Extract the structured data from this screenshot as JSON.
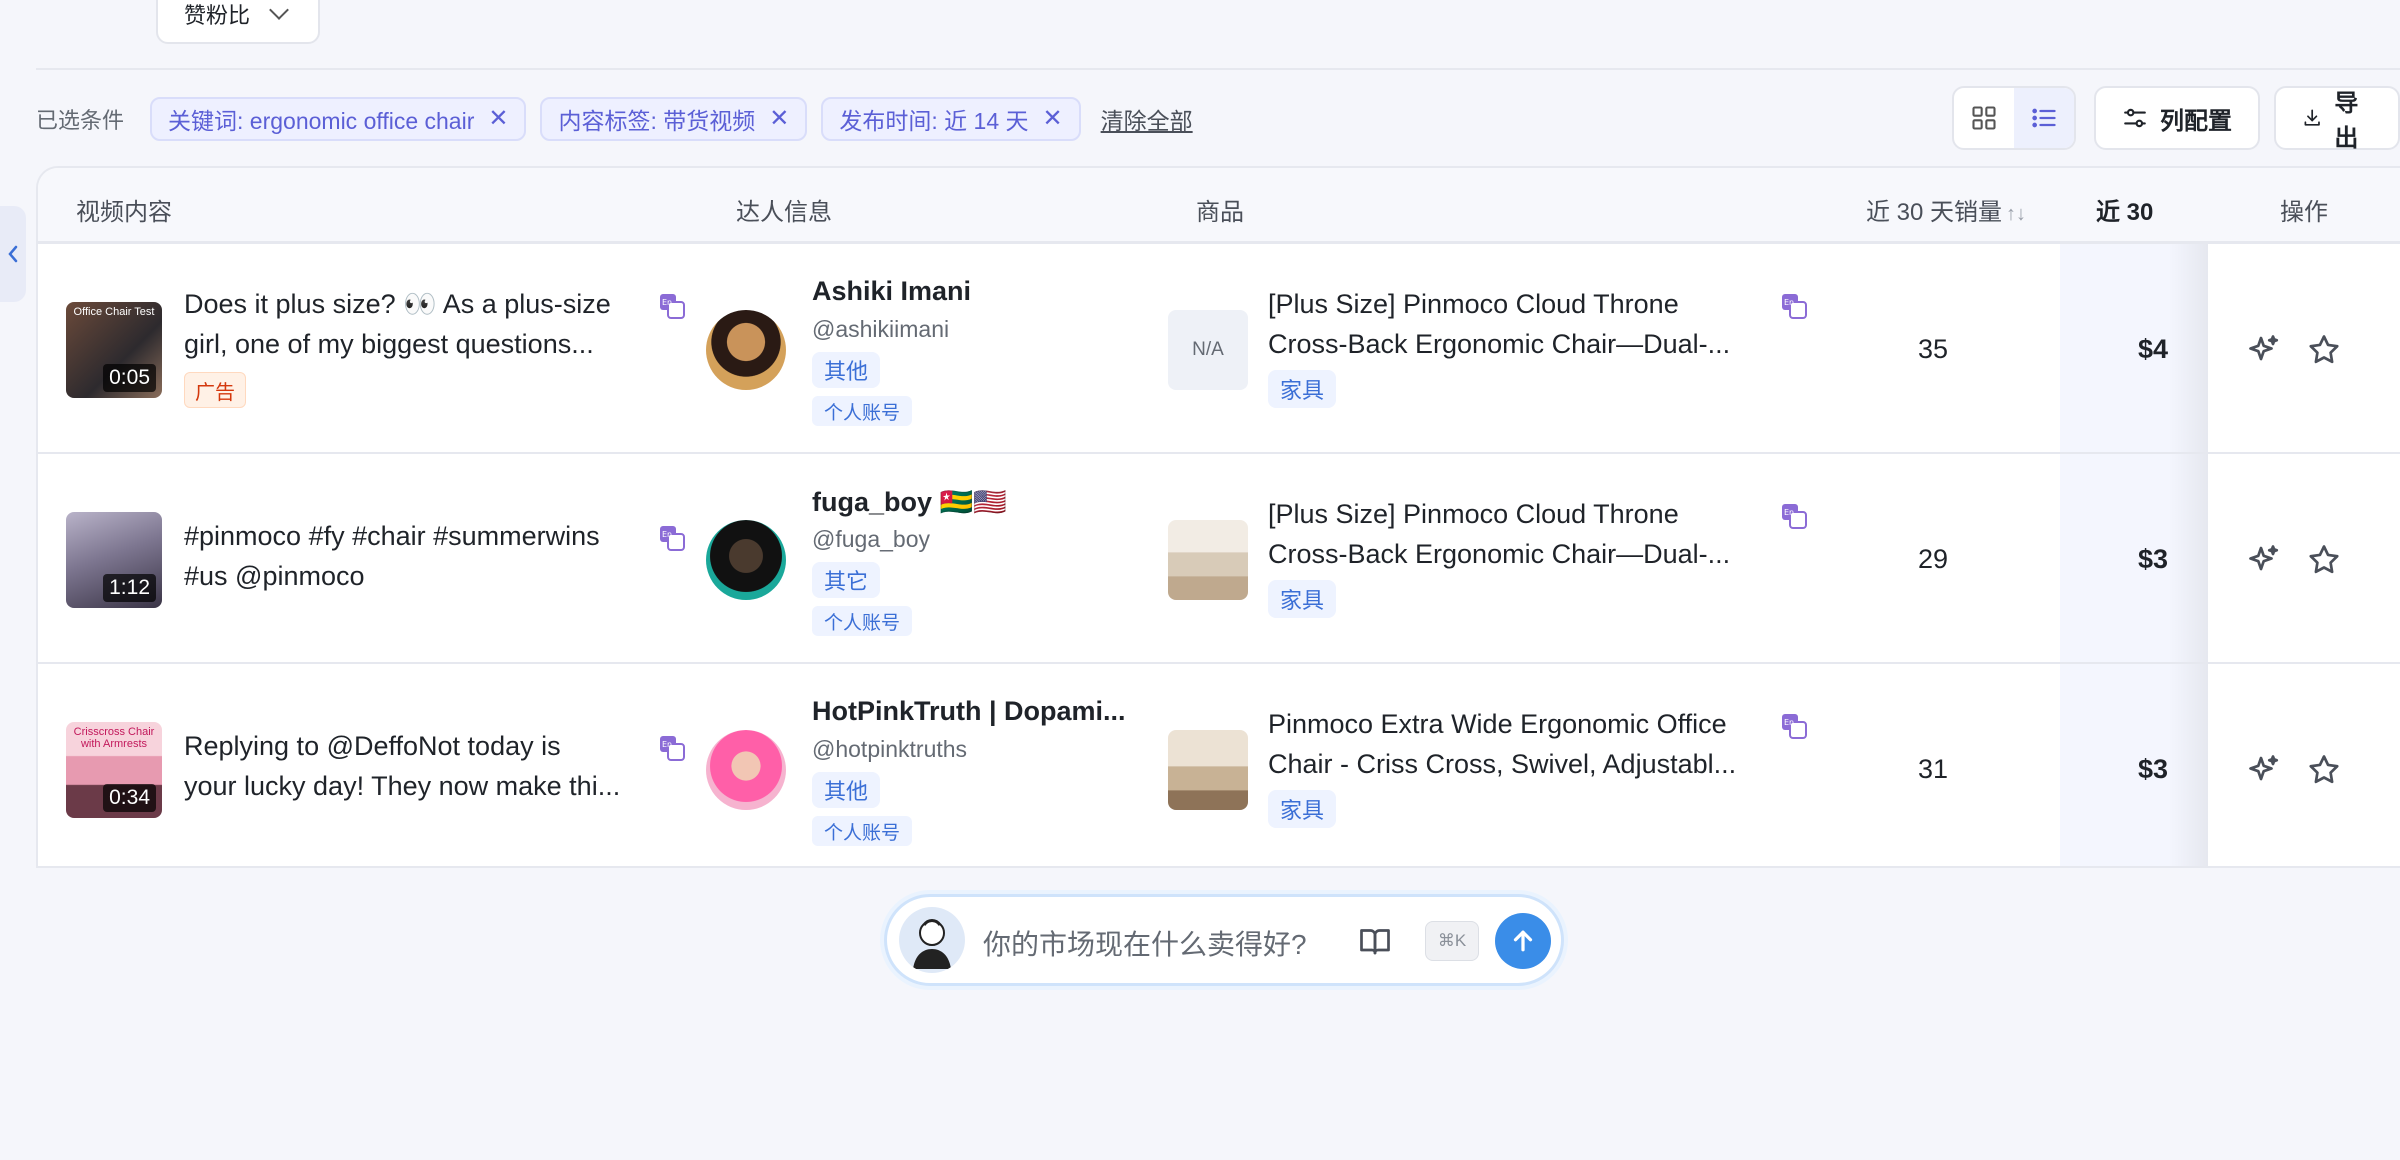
{
  "toolbar": {
    "sort_value": "赞粉比",
    "filter_label": "已选条件",
    "chips": [
      {
        "label": "关键词: ergonomic office chair"
      },
      {
        "label": "内容标签: 带货视频"
      },
      {
        "label": "发布时间: 近 14 天"
      }
    ],
    "clear_all": "清除全部",
    "columns_btn": "列配置",
    "export_btn": "导出"
  },
  "table": {
    "headers": {
      "video": "视频内容",
      "creator": "达人信息",
      "product": "商品",
      "sales": "近 30 天销量",
      "gmv": "近 30",
      "actions": "操作"
    },
    "rows": [
      {
        "duration": "0:05",
        "thumb_caption": "Office Chair Test",
        "video_title_l1": "Does it plus size? 👀 As a plus-size",
        "video_title_l2": "girl, one of my biggest questions...",
        "ad_tag": "广告",
        "creator_name": "Ashiki Imani",
        "handle": "@ashikiimani",
        "category": "其他",
        "account_type": "个人账号",
        "product_img": "N/A",
        "product_l1": "[Plus Size] Pinmoco Cloud Throne",
        "product_l2": "Cross-Back Ergonomic Chair—Dual-...",
        "product_tag": "家具",
        "sales": "35",
        "gmv": "$4"
      },
      {
        "duration": "1:12",
        "thumb_caption": "",
        "video_title_l1": "#pinmoco #fy #chair #summerwins",
        "video_title_l2": "#us @pinmoco",
        "ad_tag": "",
        "creator_name": "fuga_boy 🇹🇬🇺🇸",
        "handle": "@fuga_boy",
        "category": "其它",
        "account_type": "个人账号",
        "product_img": "",
        "product_l1": "[Plus Size] Pinmoco Cloud Throne",
        "product_l2": "Cross-Back Ergonomic Chair—Dual-...",
        "product_tag": "家具",
        "sales": "29",
        "gmv": "$3"
      },
      {
        "duration": "0:34",
        "thumb_caption": "Crisscross Chair with Armrests",
        "video_title_l1": "Replying to @DeffoNot today is",
        "video_title_l2": "your lucky day! They now make thi...",
        "ad_tag": "",
        "creator_name": "HotPinkTruth | Dopami...",
        "handle": "@hotpinktruths",
        "category": "其他",
        "account_type": "个人账号",
        "product_img": "",
        "product_l1": "Pinmoco Extra Wide Ergonomic Office",
        "product_l2": "Chair - Criss Cross, Swivel, Adjustabl...",
        "product_tag": "家具",
        "sales": "31",
        "gmv": "$3"
      }
    ]
  },
  "chat": {
    "placeholder": "你的市场现在什么卖得好?",
    "shortcut": "⌘K"
  },
  "icons": [
    "chevron-down-icon",
    "close-icon",
    "grid-view-icon",
    "list-view-icon",
    "sliders-icon",
    "download-icon",
    "translate-icon",
    "sparkle-icon",
    "star-icon",
    "chevron-left-icon",
    "book-icon",
    "arrow-up-icon"
  ],
  "colors": {
    "accent": "#5b5fd6",
    "primary_blue": "#3a8de8",
    "tag_blue": "#3b6fd6",
    "ad_orange": "#d4380d"
  }
}
